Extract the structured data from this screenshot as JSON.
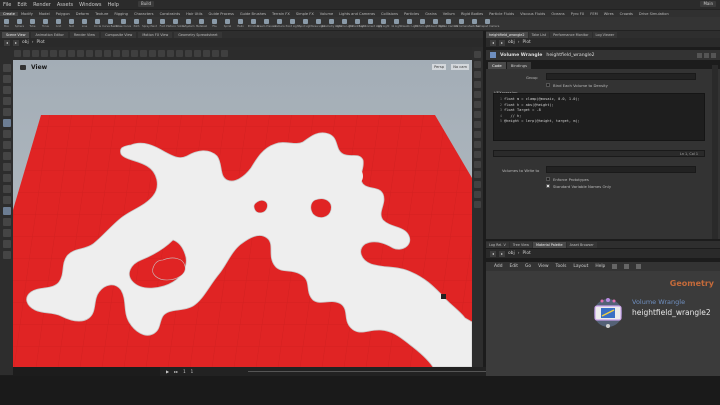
{
  "menubar": {
    "items": [
      "File",
      "Edit",
      "Render",
      "Assets",
      "Windows",
      "Help"
    ],
    "build_label": "Build",
    "desktop_label": "Main"
  },
  "shelf": {
    "tabs": [
      "Create",
      "Modify",
      "Model",
      "Polygon",
      "Deform",
      "Texture",
      "Rigging",
      "Characters",
      "Constraints",
      "Hair Utils",
      "Guide Process",
      "Guide Brushes",
      "Terrain FX",
      "Simple FX",
      "Volume"
    ],
    "active_tab_index": 0,
    "right_tabs": [
      "Lights and Cameras",
      "Collisions",
      "Particles",
      "Grains",
      "Vellum",
      "Rigid Bodies",
      "Particle Fluids",
      "Viscous Fluids",
      "Oceans",
      "Pyro FX",
      "FEM",
      "Wires",
      "Crowds",
      "Drive Simulation"
    ],
    "tools": [
      "Box",
      "Sphere",
      "Tube",
      "Torus",
      "Grid",
      "Null",
      "Line",
      "Circle",
      "Curve Bezier",
      "Draw Curve",
      "Path",
      "Spray Paint",
      "Font",
      "Platonic Solids",
      "L-System",
      "Metaball",
      "File",
      "Spiral",
      "Helix",
      "Primitive",
      "Dream Preview",
      "Camera",
      "Point Light",
      "Spot Light",
      "Area Light",
      "Geometry Light",
      "Volume Light",
      "Distant Light",
      "Environment Light",
      "Sky Light",
      "GI Light",
      "Caustic Light",
      "Portal Light",
      "Ambient Light",
      "Stereo Camera",
      "VR Camera",
      "Switcher",
      "Gamepad Camera"
    ]
  },
  "left_pane": {
    "tabs": [
      "Scene View",
      "Animation Editor",
      "Render View",
      "Composite View",
      "Motion FX View",
      "Geometry Spreadsheet"
    ],
    "active_tab_index": 0,
    "path": [
      "obj",
      "Plot"
    ],
    "viewport": {
      "label": "View",
      "camera_menu": "Persp",
      "camera2_menu": "No cam"
    }
  },
  "timeline": {
    "frame": "1",
    "frame_start": "1",
    "frame_end": "240"
  },
  "right_pane": {
    "tabs": [
      "heightfield_wrangle2",
      "Take List",
      "Performance Monitor",
      "Log Viewer"
    ],
    "active_tab_index": 0,
    "path": [
      "obj",
      "Plot"
    ],
    "param_type": "Volume Wrangle",
    "node_name": "heightfield_wrangle2",
    "param_tabs": [
      "Code",
      "Bindings"
    ],
    "active_param_tab": 0,
    "group_label": "Group",
    "bind_each_label": "Bind Each Volume to Density",
    "vexpression_label": "VEXpression",
    "code_lines": [
      "float m = clamp(@mosaic, 0.0, 1.0);",
      "float h = abs(@height);",
      "float Target = -8",
      "   // h;",
      "@height = lerp(@height, target, m);"
    ],
    "cursor_pos": "Ln 1, Col 1",
    "volumes_label": "Volumes to Write to",
    "enforce_label": "Enforce Prototypes",
    "enforce_checked": false,
    "standard_label": "Standard Variable Names Only",
    "standard_checked": true
  },
  "network_pane": {
    "tabs": [
      "Tree View",
      "Material Palette",
      "Asset Browser"
    ],
    "log_tab": "Log Rel. V",
    "active_tab_index": 1,
    "path": [
      "obj",
      "Plot"
    ],
    "menu": [
      "Add",
      "Edit",
      "Go",
      "View",
      "Tools",
      "Layout",
      "Help"
    ],
    "context_label": "Geometry",
    "node": {
      "type": "Volume Wrangle",
      "name": "heightfield_wrangle2"
    }
  },
  "colors": {
    "terrain_red": "#e02424",
    "terrain_white": "#eeeeee",
    "context_orange": "#c46a3a",
    "node_type_blue": "#6f8fc0"
  }
}
